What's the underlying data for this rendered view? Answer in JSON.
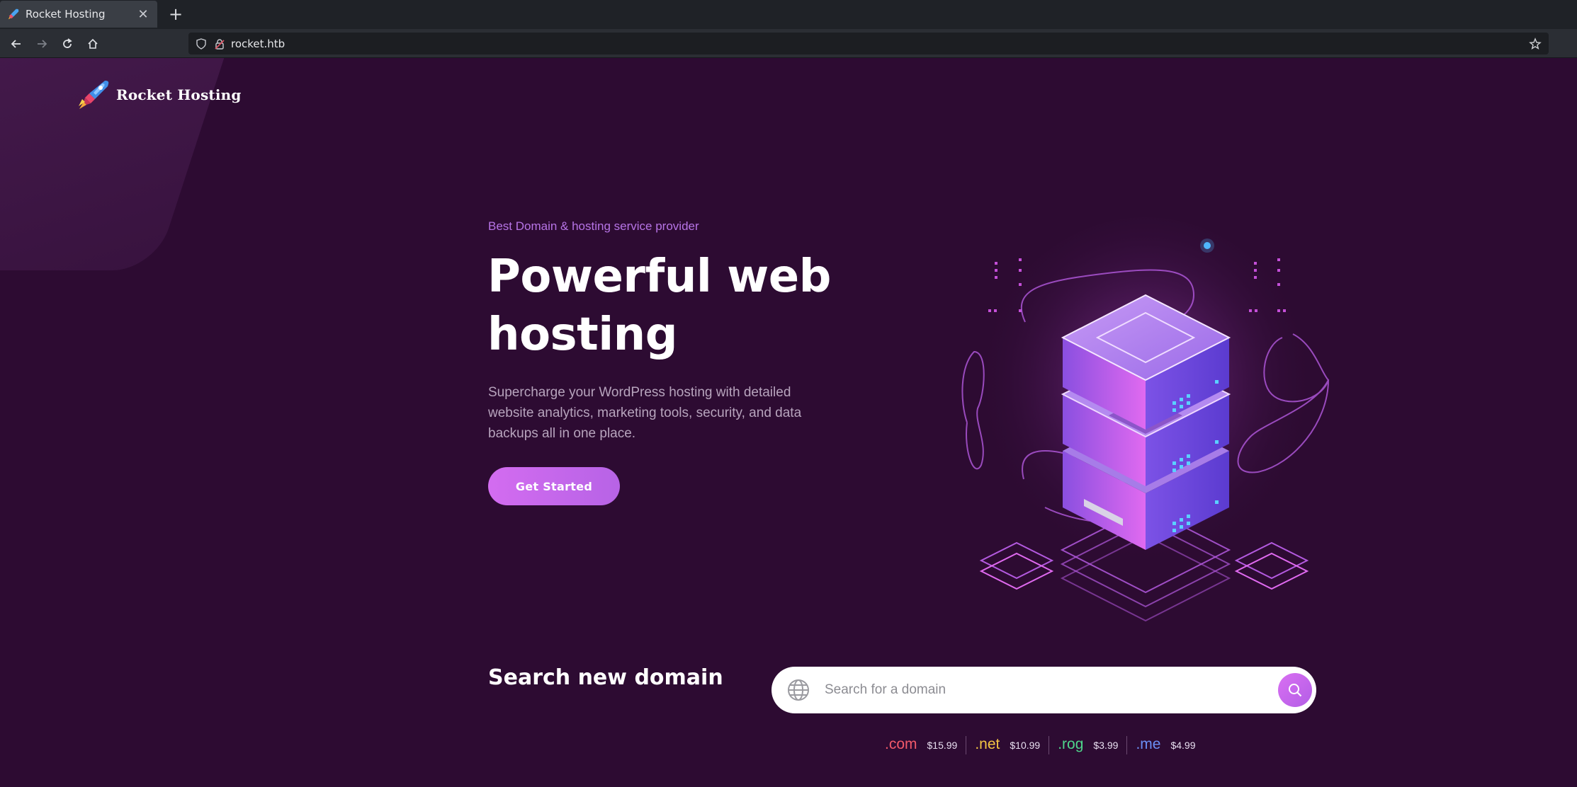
{
  "browser": {
    "tab_title": "Rocket Hosting",
    "url": "rocket.htb"
  },
  "brand": {
    "name": "Rocket Hosting"
  },
  "hero": {
    "tagline": "Best Domain & hosting service provider",
    "headline": "Powerful web hosting",
    "description": "Supercharge your WordPress hosting with detailed website analytics, marketing tools, security, and data backups all in one place.",
    "cta_label": "Get Started"
  },
  "search": {
    "title": "Search new domain",
    "placeholder": "Search for a domain"
  },
  "tlds": [
    {
      "name": ".com",
      "price": "$15.99",
      "color": "#f2596a"
    },
    {
      "name": ".net",
      "price": "$10.99",
      "color": "#f4c543"
    },
    {
      "name": ".rog",
      "price": "$3.99",
      "color": "#4fd58b"
    },
    {
      "name": ".me",
      "price": "$4.99",
      "color": "#6b8ff5"
    }
  ],
  "colors": {
    "background": "#2d0b32",
    "accent": "#c966ec",
    "tagline": "#b774e6"
  },
  "icons": {
    "back": "arrow-left-icon",
    "forward": "arrow-right-icon",
    "reload": "reload-icon",
    "home": "home-icon",
    "bookmark": "star-icon",
    "search": "magnifier-icon",
    "globe": "globe-icon"
  }
}
